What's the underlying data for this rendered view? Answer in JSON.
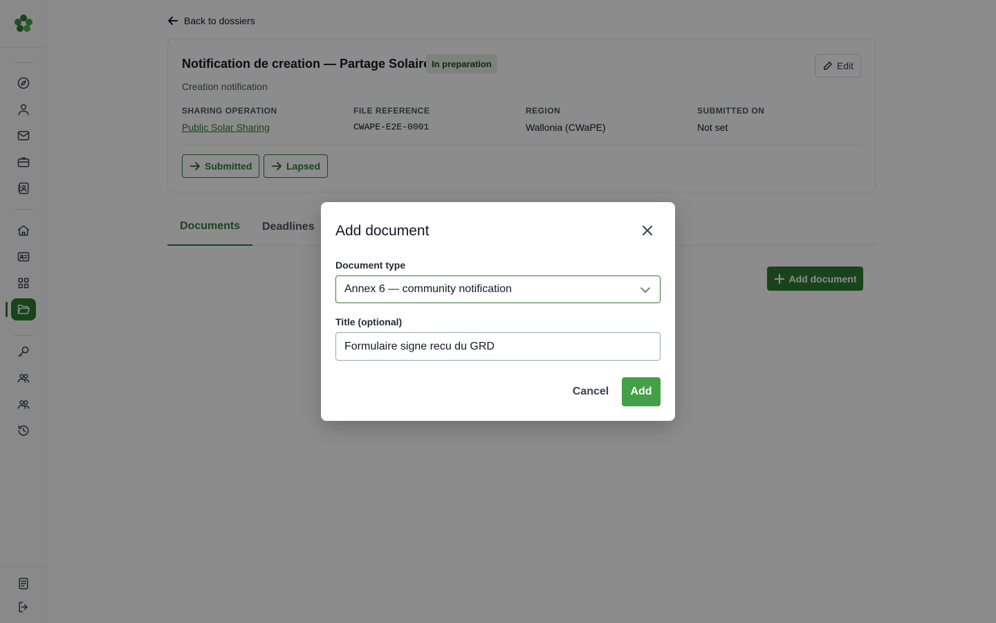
{
  "colors": {
    "accent": "#2e7d32",
    "add_button": "#43a047",
    "badge_bg": "#e5ede3",
    "overlay": "rgba(0,0,0,0.45)"
  },
  "sidebar": {
    "logo_icon": "clover-logo-icon",
    "top_group": [
      "compass-icon",
      "user-icon",
      "mail-icon",
      "briefcase-icon",
      "contact-card-icon"
    ],
    "middle_group": [
      "home-icon",
      "id-card-icon",
      "grid-icon",
      "folder-open-icon"
    ],
    "bottom_group": [
      "key-icon",
      "users-icon",
      "users-alt-icon",
      "history-icon"
    ],
    "footer_group": [
      "notes-icon",
      "logout-icon"
    ],
    "active_item": "folder-open-icon"
  },
  "back_link": {
    "label": "Back to dossiers"
  },
  "dossier": {
    "title": "Notification de creation — Partage Solaire",
    "status_badge": "In preparation",
    "edit_label": "Edit",
    "subtitle": "Creation notification",
    "meta": [
      {
        "label": "SHARING OPERATION",
        "value": "Public Solar Sharing"
      },
      {
        "label": "FILE REFERENCE",
        "value": "CWAPE-E2E-0001"
      },
      {
        "label": "REGION",
        "value": "Wallonia (CWaPE)"
      },
      {
        "label": "SUBMITTED ON",
        "value": "Not set"
      }
    ],
    "transitions": [
      "Submitted",
      "Lapsed"
    ]
  },
  "tabs": [
    {
      "label": "Documents",
      "active": true
    },
    {
      "label": "Deadlines",
      "active": false
    }
  ],
  "add_document_label": "Add document",
  "modal": {
    "title": "Add document",
    "document_type_label": "Document type",
    "document_type_value": "Annex 6 — community notification",
    "title_label": "Title (optional)",
    "title_value": "Formulaire signe recu du GRD",
    "cancel_label": "Cancel",
    "add_label": "Add"
  }
}
